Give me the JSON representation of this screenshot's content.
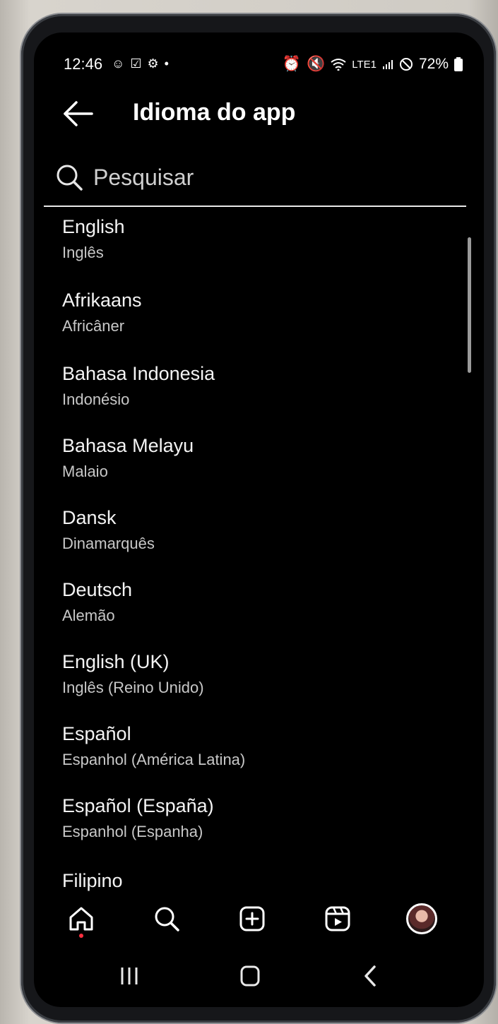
{
  "status_bar": {
    "time": "12:46",
    "left_icons": [
      "whatsapp-icon",
      "check-box-icon",
      "settings-icon",
      "dot-icon"
    ],
    "battery": "72%",
    "network_label": "LTE1"
  },
  "header": {
    "title": "Idioma do app"
  },
  "search": {
    "placeholder": "Pesquisar",
    "value": ""
  },
  "languages": [
    {
      "name": "English",
      "native": "Inglês"
    },
    {
      "name": "Afrikaans",
      "native": "Africâner"
    },
    {
      "name": "Bahasa Indonesia",
      "native": "Indonésio"
    },
    {
      "name": "Bahasa Melayu",
      "native": "Malaio"
    },
    {
      "name": "Dansk",
      "native": "Dinamarquês"
    },
    {
      "name": "Deutsch",
      "native": "Alemão"
    },
    {
      "name": "English (UK)",
      "native": "Inglês (Reino Unido)"
    },
    {
      "name": "Español",
      "native": "Espanhol (América Latina)"
    },
    {
      "name": "Español (España)",
      "native": "Espanhol (Espanha)"
    },
    {
      "name": "Filipino",
      "native": ""
    }
  ],
  "tab_bar": {
    "tabs": [
      "home-icon",
      "search-icon",
      "create-icon",
      "reels-icon",
      "profile-avatar"
    ],
    "active": "home"
  },
  "colors": {
    "background": "#000000",
    "text": "#f4f4f4",
    "subtext": "#c8c8c8",
    "notification_dot": "#ff3040"
  }
}
